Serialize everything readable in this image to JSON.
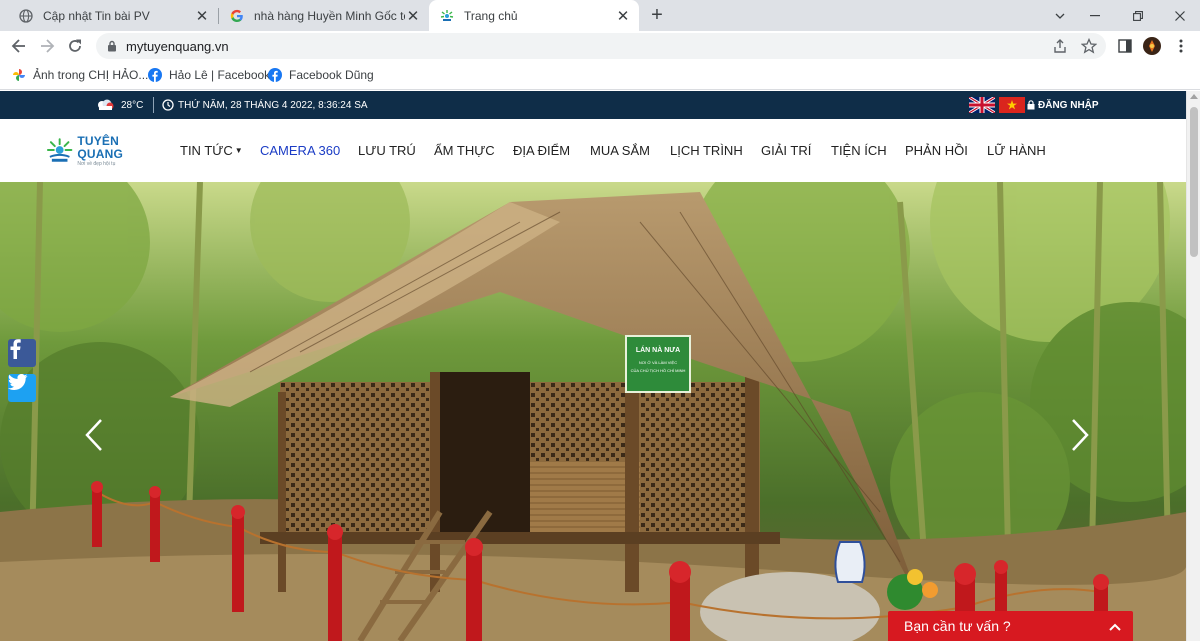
{
  "browser": {
    "tabs": [
      {
        "title": "Cập nhật Tin bài PV",
        "icon": "globe-icon",
        "active": false
      },
      {
        "title": "nhà hàng Huyền Minh Gốc tếch - ",
        "icon": "google-icon",
        "active": false
      },
      {
        "title": "Trang chủ",
        "icon": "site-logo-icon",
        "active": true
      }
    ],
    "url": "mytuyenquang.vn",
    "bookmarks": [
      {
        "label": "Ảnh trong CHỊ HẢO...",
        "icon": "google-photos-icon"
      },
      {
        "label": "Hảo Lê | Facebook",
        "icon": "facebook-icon"
      },
      {
        "label": "Facebook Dũng",
        "icon": "facebook-icon"
      }
    ]
  },
  "site": {
    "topbar": {
      "temperature": "28°C",
      "datetime": "THỨ NĂM, 28 THÁNG 4 2022, 8:36:24 SA",
      "login": "ĐĂNG NHẬP"
    },
    "logo": {
      "brand": "TUYÊN QUANG",
      "slogan": "Nơi về đẹp hội tụ"
    },
    "menu": [
      {
        "label": "TIN TỨC",
        "dropdown": true
      },
      {
        "label": "CAMERA 360",
        "dropdown": false
      },
      {
        "label": "LƯU TRÚ",
        "dropdown": false
      },
      {
        "label": "ẨM THỰC",
        "dropdown": false
      },
      {
        "label": "ĐỊA ĐIỂM",
        "dropdown": false
      },
      {
        "label": "MUA SẮM",
        "dropdown": false
      },
      {
        "label": "LỊCH TRÌNH",
        "dropdown": false
      },
      {
        "label": "GIẢI TRÍ",
        "dropdown": false
      },
      {
        "label": "TIỆN ÍCH",
        "dropdown": false
      },
      {
        "label": "PHẢN HỒI",
        "dropdown": false
      },
      {
        "label": "LỮ HÀNH",
        "dropdown": false
      }
    ],
    "hero": {
      "sign_title": "LÁN NÀ NƯA",
      "sign_line1": "NƠI Ở VÀ LÀM VIỆC",
      "sign_line2": "CỦA CHỦ TỊCH HỒ CHÍ MINH"
    },
    "consult_label": "Bạn cần tư vấn ?",
    "colors": {
      "topbar": "#0f2d48",
      "accent_link": "#1b3cc5",
      "consult": "#d71920",
      "facebook": "#3b5998",
      "twitter": "#1da1f2"
    }
  }
}
